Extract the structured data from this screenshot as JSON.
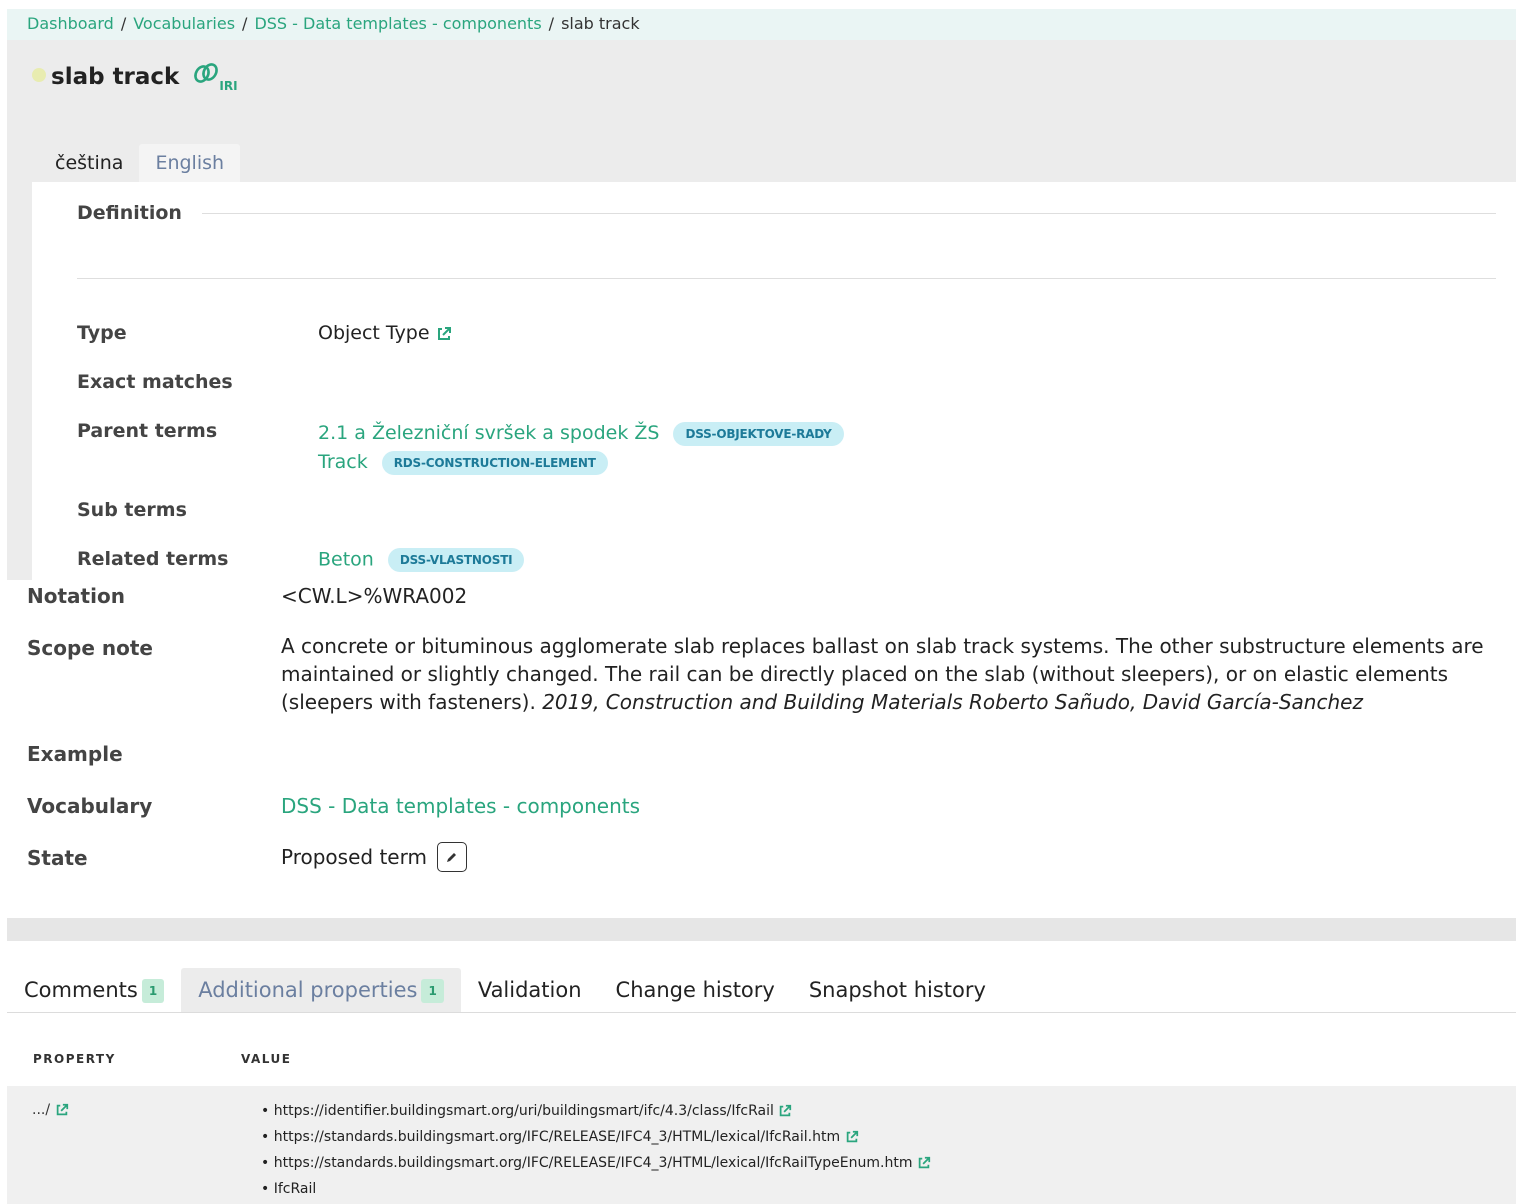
{
  "breadcrumb": {
    "items": [
      "Dashboard",
      "Vocabularies",
      "DSS - Data templates - components"
    ],
    "current": "slab track",
    "separator": "/"
  },
  "term": {
    "title": "slab track",
    "iri_label": "IRI"
  },
  "languages": {
    "tabs": [
      "čeština",
      "English"
    ],
    "active": "English"
  },
  "definition": {
    "label": "Definition",
    "text": ""
  },
  "properties": {
    "type": {
      "label": "Type",
      "value": "Object Type"
    },
    "exact_matches": {
      "label": "Exact matches"
    },
    "parent_terms": {
      "label": "Parent terms",
      "items": [
        {
          "name": "2.1 a Železniční svršek a spodek ŽS",
          "badge": "DSS-OBJEKTOVE-RADY"
        },
        {
          "name": "Track",
          "badge": "RDS-CONSTRUCTION-ELEMENT"
        }
      ]
    },
    "sub_terms": {
      "label": "Sub terms"
    },
    "related_terms": {
      "label": "Related terms",
      "items": [
        {
          "name": "Beton",
          "badge": "DSS-VLASTNOSTI"
        }
      ]
    },
    "notation": {
      "label": "Notation",
      "value": "<CW.L>%WRA002"
    },
    "scope_note": {
      "label": "Scope note",
      "text": "A concrete or bituminous agglomerate slab replaces ballast on slab track systems. The other substructure elements are maintained or slightly changed. The rail can be directly placed on the slab (without sleepers), or on elastic elements (sleepers with fasteners).",
      "citation": "2019, Construction and Building Materials Roberto Sañudo, David García-Sanchez"
    },
    "example": {
      "label": "Example"
    },
    "vocabulary": {
      "label": "Vocabulary",
      "value": "DSS - Data templates - components"
    },
    "state": {
      "label": "State",
      "value": "Proposed term"
    }
  },
  "bottom_tabs": [
    {
      "label": "Comments",
      "count": "1"
    },
    {
      "label": "Additional properties",
      "count": "1"
    },
    {
      "label": "Validation"
    },
    {
      "label": "Change history"
    },
    {
      "label": "Snapshot history"
    }
  ],
  "active_bottom_tab": "Additional properties",
  "table": {
    "headers": [
      "PROPERTY",
      "VALUE"
    ],
    "rows": [
      {
        "property": ".../",
        "values": [
          "https://identifier.buildingsmart.org/uri/buildingsmart/ifc/4.3/class/IfcRail",
          "https://standards.buildingsmart.org/IFC/RELEASE/IFC4_3/HTML/lexical/IfcRail.htm",
          "https://standards.buildingsmart.org/IFC/RELEASE/IFC4_3/HTML/lexical/IfcRailTypeEnum.htm",
          "IfcRail"
        ]
      }
    ]
  },
  "colors": {
    "link": "#2aa57e",
    "badge_bg": "#c9eef5",
    "badge_text": "#1d7a98",
    "breadcrumb_bg": "#eaf5f4",
    "title_area_bg": "#ececec",
    "count_bg": "#c6ecd9"
  },
  "icons": [
    "iri-link-icon",
    "external-link-icon",
    "pencil-icon"
  ]
}
